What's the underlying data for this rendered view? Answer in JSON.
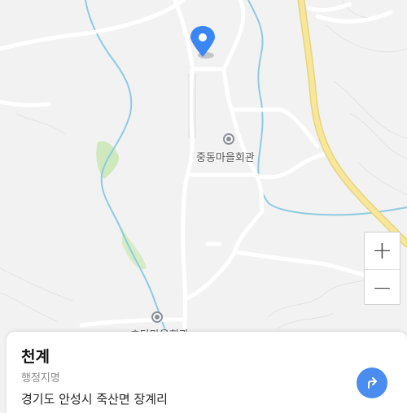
{
  "map": {
    "poi": [
      {
        "name": "중동마을회관"
      },
      {
        "name": "초당마을회관"
      }
    ],
    "colors": {
      "background": "#f2f2f2",
      "road": "#ffffff",
      "highway": "#f7e79a",
      "water": "#8ecbe0",
      "green": "#cfe8bd",
      "pin": "#3a86f5"
    }
  },
  "controls": {
    "zoom_in_label": "+",
    "zoom_out_label": "−"
  },
  "card": {
    "title": "천계",
    "type": "행정지명",
    "address": "경기도 안성시 죽산면 장계리",
    "directions_icon": "directions-icon"
  }
}
